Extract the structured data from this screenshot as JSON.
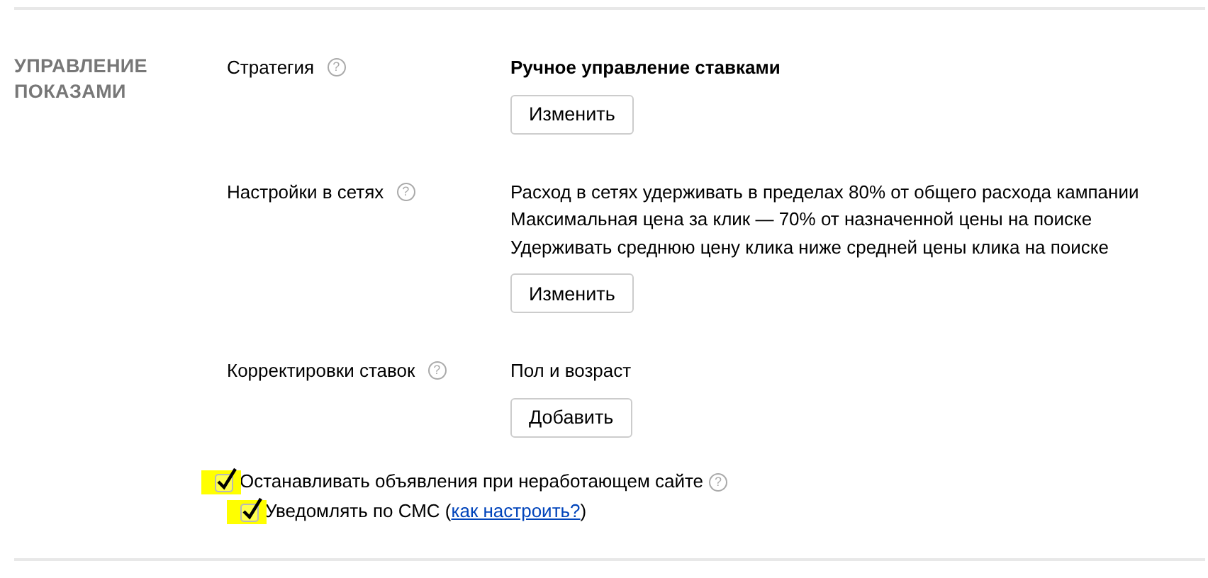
{
  "section_title": "УПРАВЛЕНИЕ ПОКАЗАМИ",
  "settings": [
    {
      "label": "Стратегия",
      "help": "?",
      "kind": "bold",
      "lines": [
        "Ручное управление ставками"
      ],
      "button": "Изменить"
    },
    {
      "label": "Настройки в сетях",
      "help": "?",
      "kind": "plain",
      "lines": [
        "Расход в сетях удерживать в пределах 80% от общего расхода кампании",
        "Максимальная цена за клик — 70% от назначенной цены на поиске",
        "Удерживать среднюю цену клика ниже средней цены клика на поиске"
      ],
      "button": "Изменить"
    },
    {
      "label": "Корректировки ставок",
      "help": "?",
      "kind": "plain",
      "lines": [
        "Пол и возраст"
      ],
      "button": "Добавить"
    }
  ],
  "options": [
    {
      "label": "Останавливать объявления при неработающем сайте",
      "help": "?",
      "checked": true,
      "highlighted": true
    },
    {
      "label": "Уведомлять по СМС (",
      "link": "как настроить?",
      "after": ")",
      "checked": true,
      "highlighted": true
    }
  ]
}
